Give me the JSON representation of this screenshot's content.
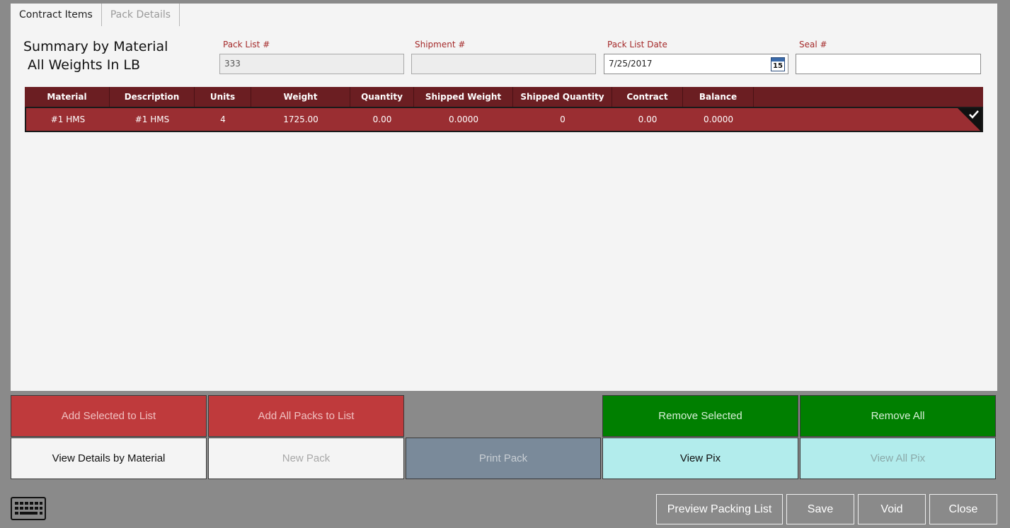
{
  "tabs": [
    {
      "label": "Contract Items",
      "active": true
    },
    {
      "label": "Pack Details",
      "active": false
    }
  ],
  "summary": {
    "title": "Summary by Material",
    "subtitle": "All Weights In LB"
  },
  "fields": {
    "pack_list": {
      "label": "Pack List #",
      "value": "333"
    },
    "shipment": {
      "label": "Shipment #",
      "value": ""
    },
    "pack_list_date": {
      "label": "Pack List Date",
      "value": "7/25/2017",
      "calendar_day": "15"
    },
    "seal": {
      "label": "Seal #",
      "value": ""
    }
  },
  "grid": {
    "columns": [
      "Material",
      "Description",
      "Units",
      "Weight",
      "Quantity",
      "Shipped Weight",
      "Shipped Quantity",
      "Contract",
      "Balance"
    ],
    "rows": [
      {
        "selected": true,
        "cells": [
          "#1 HMS",
          "#1 HMS",
          "4",
          "1725.00",
          "0.00",
          "0.0000",
          "0",
          "0.00",
          "0.0000"
        ]
      }
    ]
  },
  "buttons": {
    "add_selected": "Add Selected to List",
    "add_all_packs": "Add All Packs to List",
    "remove_selected": "Remove Selected",
    "remove_all": "Remove All",
    "view_details": "View Details by Material",
    "new_pack": "New Pack",
    "print_pack": "Print Pack",
    "view_pix": "View Pix",
    "view_all_pix": "View All Pix"
  },
  "footer": {
    "preview": "Preview Packing List",
    "save": "Save",
    "void": "Void",
    "close": "Close"
  },
  "colors": {
    "header": "#6b1e22",
    "selected_row": "#9a2e32",
    "red_button": "#bf3a3c",
    "green_button": "#007f00",
    "cyan_button": "#b2ecec",
    "label_red": "#a52a2a"
  }
}
